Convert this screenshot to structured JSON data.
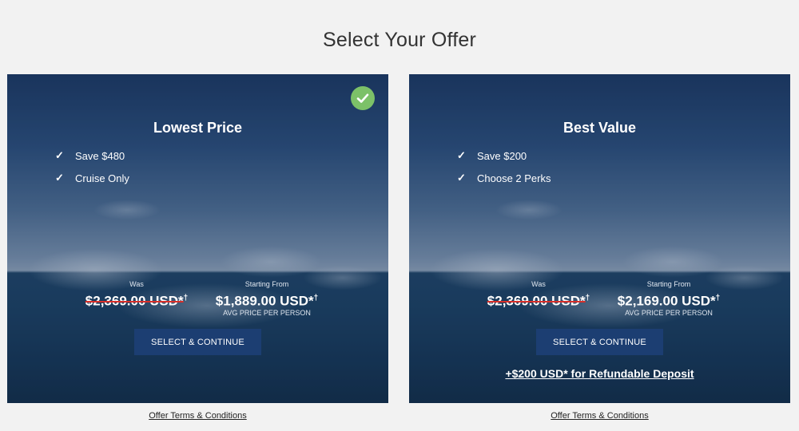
{
  "page": {
    "title": "Select Your Offer"
  },
  "offers": [
    {
      "title": "Lowest Price",
      "features": [
        "Save $480",
        "Cruise Only"
      ],
      "selected": true,
      "was_label": "Was",
      "was_price": "$2,369.00 USD*",
      "was_marker": "†",
      "from_label": "Starting From",
      "from_price": "$1,889.00 USD*",
      "from_marker": "†",
      "per_person": "AVG PRICE PER PERSON",
      "button_label": "SELECT & CONTINUE",
      "terms_label": "Offer Terms & Conditions"
    },
    {
      "title": "Best Value",
      "features": [
        "Save $200",
        "Choose 2 Perks"
      ],
      "selected": false,
      "was_label": "Was",
      "was_price": "$2,369.00 USD*",
      "was_marker": "†",
      "from_label": "Starting From",
      "from_price": "$2,169.00 USD*",
      "from_marker": "†",
      "per_person": "AVG PRICE PER PERSON",
      "button_label": "SELECT & CONTINUE",
      "deposit_label": "+$200 USD* for Refundable Deposit",
      "terms_label": "Offer Terms & Conditions"
    }
  ],
  "icons": {
    "feature": "checkmark-icon",
    "selected": "check-circle-icon"
  },
  "colors": {
    "selected_badge": "#7cc168",
    "button": "#1c3e72",
    "strike": "#d9302a"
  }
}
